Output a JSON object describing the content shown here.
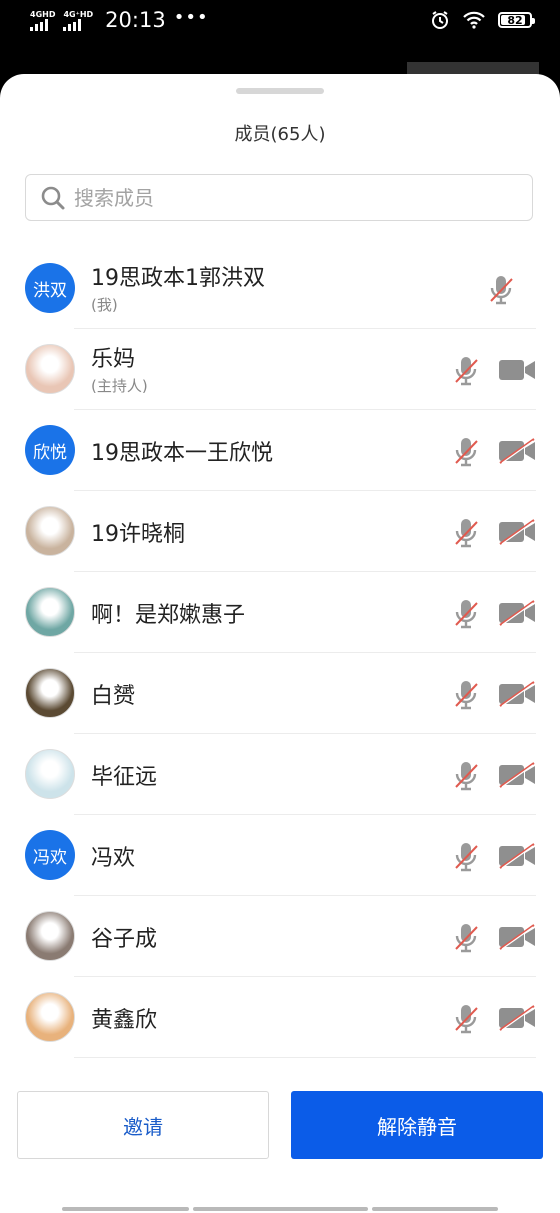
{
  "status_bar": {
    "signal1_label": "4GHD",
    "signal2_label": "4G⁺HD",
    "time": "20:13",
    "more_dots": "•••",
    "battery": "82"
  },
  "sheet": {
    "title": "成员(65人)",
    "search_placeholder": "搜索成员"
  },
  "members": [
    {
      "name": "19思政本1郭洪双",
      "sub": "(我)",
      "avatar_text": "洪双",
      "avatar_type": "text"
    },
    {
      "name": "乐妈",
      "sub": "(主持人)",
      "avatar_text": "",
      "avatar_type": "photo",
      "avatar_color": "#e9c6b5"
    },
    {
      "name": "19思政本一王欣悦",
      "sub": "",
      "avatar_text": "欣悦",
      "avatar_type": "text"
    },
    {
      "name": "19许晓桐",
      "sub": "",
      "avatar_text": "",
      "avatar_type": "photo",
      "avatar_color": "#c9b39e"
    },
    {
      "name": "啊！是郑嫰惠子",
      "sub": "",
      "avatar_text": "",
      "avatar_type": "photo",
      "avatar_color": "#6fa7a4"
    },
    {
      "name": "白赟",
      "sub": "",
      "avatar_text": "",
      "avatar_type": "photo",
      "avatar_color": "#5b4a33"
    },
    {
      "name": "毕征远",
      "sub": "",
      "avatar_text": "",
      "avatar_type": "photo",
      "avatar_color": "#cde3ea"
    },
    {
      "name": "冯欢",
      "sub": "",
      "avatar_text": "冯欢",
      "avatar_type": "text"
    },
    {
      "name": "谷子成",
      "sub": "",
      "avatar_text": "",
      "avatar_type": "photo",
      "avatar_color": "#8a7b72"
    },
    {
      "name": "黄鑫欣",
      "sub": "",
      "avatar_text": "",
      "avatar_type": "photo",
      "avatar_color": "#e8b27c"
    }
  ],
  "actions": {
    "invite_label": "邀请",
    "unmute_label": "解除静音"
  },
  "colors": {
    "accent": "#0b5ce8",
    "avatar_blue": "#1a73e8",
    "muted_icon_gray": "#9a9a9a",
    "muted_slash_red": "#e05a4f"
  }
}
